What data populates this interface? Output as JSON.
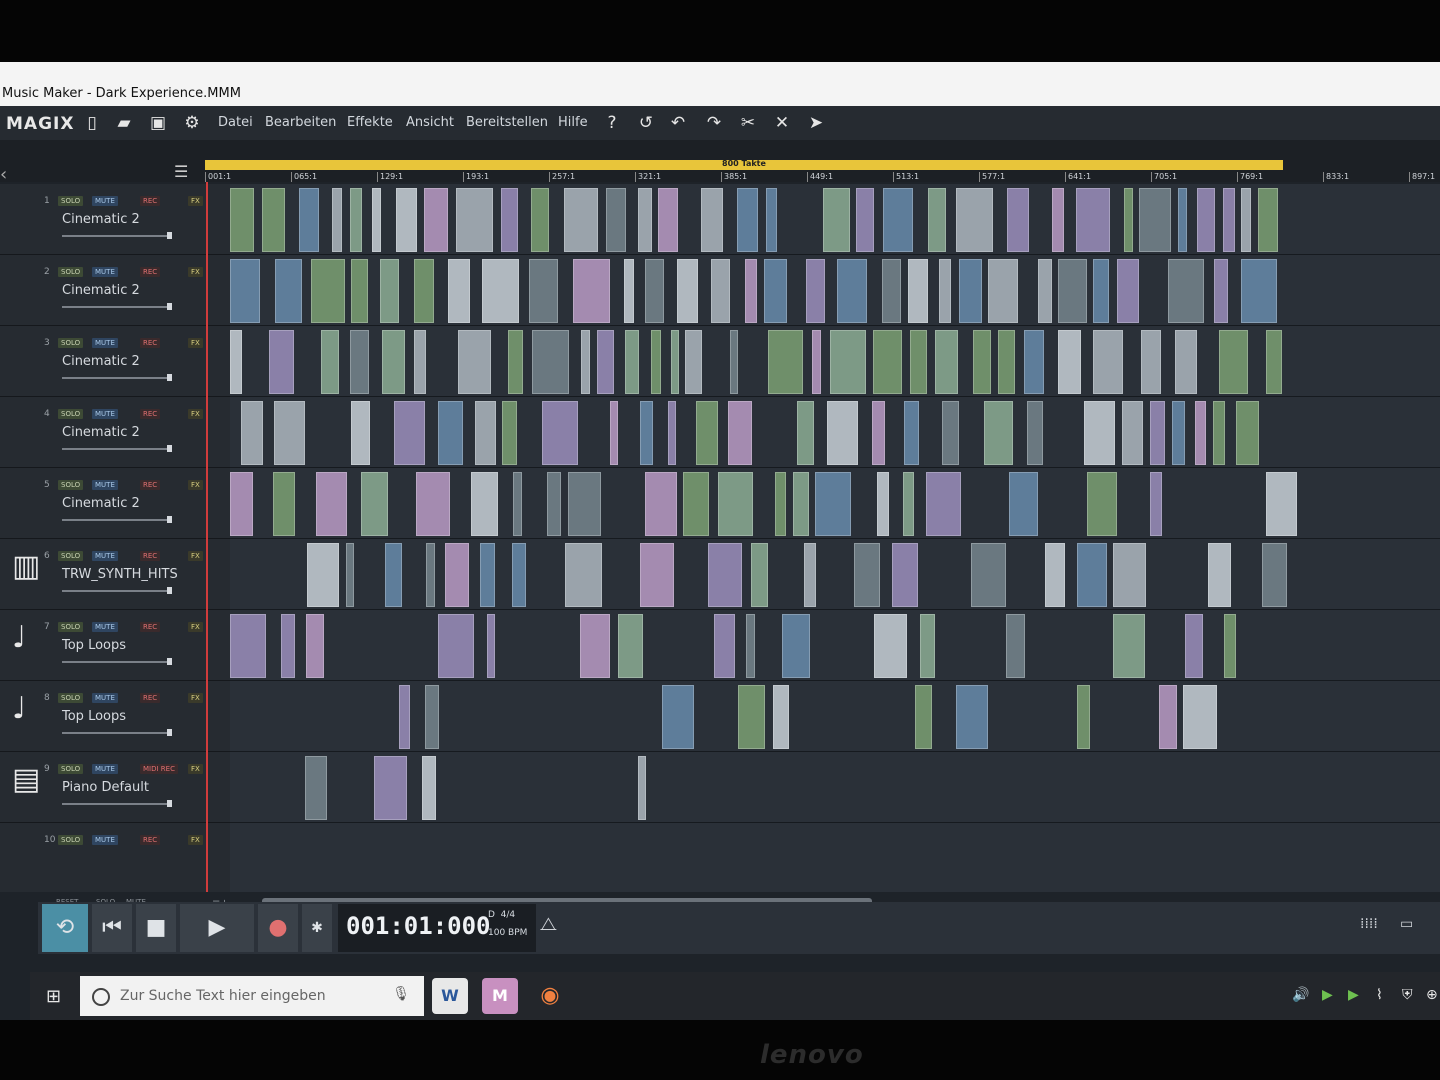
{
  "window": {
    "title": "Music Maker - Dark Experience.MMM"
  },
  "brand": {
    "logo": "MAGIX"
  },
  "menu": [
    "Datei",
    "Bearbeiten",
    "Effekte",
    "Ansicht",
    "Bereitstellen",
    "Hilfe"
  ],
  "toolbar_icons": [
    "new-file-icon",
    "open-folder-icon",
    "save-icon",
    "settings-icon",
    "help-icon",
    "undo-history-icon",
    "undo-icon",
    "redo-icon",
    "scissors-icon",
    "delete-icon",
    "mouse-mode-icon"
  ],
  "range": {
    "label": "800 Takte"
  },
  "ruler": [
    "001:1",
    "065:1",
    "129:1",
    "193:1",
    "257:1",
    "321:1",
    "385:1",
    "449:1",
    "513:1",
    "577:1",
    "641:1",
    "705:1",
    "769:1",
    "833:1",
    "897:1"
  ],
  "track_buttons": {
    "solo": "SOLO",
    "mute": "MUTE",
    "rec": "REC",
    "midi_rec": "MIDI REC",
    "fx": "FX"
  },
  "tracks": [
    {
      "num": "1",
      "name": "Cinematic 2",
      "icon": "",
      "rec": "REC"
    },
    {
      "num": "2",
      "name": "Cinematic 2",
      "icon": "",
      "rec": "REC"
    },
    {
      "num": "3",
      "name": "Cinematic 2",
      "icon": "",
      "rec": "REC"
    },
    {
      "num": "4",
      "name": "Cinematic 2",
      "icon": "",
      "rec": "REC"
    },
    {
      "num": "5",
      "name": "Cinematic 2",
      "icon": "",
      "rec": "REC"
    },
    {
      "num": "6",
      "name": "TRW_SYNTH_HITS",
      "icon": "synth-icon",
      "rec": "REC"
    },
    {
      "num": "7",
      "name": "Top Loops",
      "icon": "note-icon",
      "rec": "REC"
    },
    {
      "num": "8",
      "name": "Top Loops",
      "icon": "note-icon",
      "rec": "REC"
    },
    {
      "num": "9",
      "name": "Piano Default",
      "icon": "piano-icon",
      "rec": "MIDI REC"
    },
    {
      "num": "10",
      "name": "",
      "icon": "",
      "rec": "REC"
    }
  ],
  "footer": {
    "reset": "RESET",
    "solo": "SOLO",
    "mute": "MUTE"
  },
  "transport": {
    "position": "001:01:000",
    "key": "D",
    "signature": "4/4",
    "bpm": "100 BPM"
  },
  "taskbar": {
    "search_placeholder": "Zur Suche Text hier eingeben",
    "apps": [
      "W",
      "M"
    ]
  },
  "monitor_brand": "lenovo",
  "colors": {
    "accent": "#e8c53a",
    "playhead": "#d13c3c",
    "loop": "#4b8fa5"
  }
}
